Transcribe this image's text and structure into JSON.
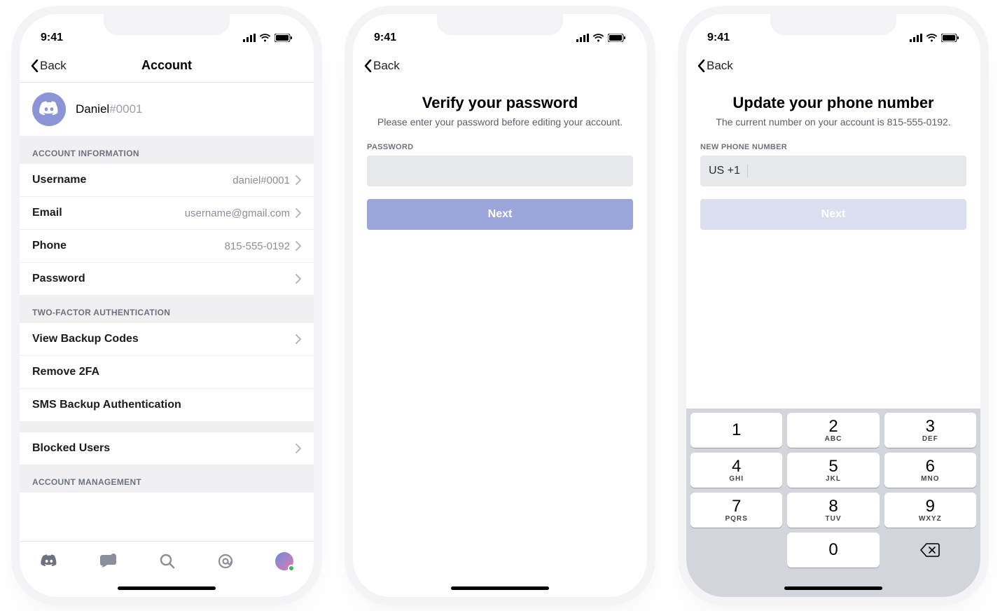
{
  "status": {
    "time": "9:41"
  },
  "screen1": {
    "back": "Back",
    "title": "Account",
    "profile": {
      "name": "Daniel",
      "discriminator": "#0001"
    },
    "sections": {
      "account_info": "ACCOUNT INFORMATION",
      "two_factor": "TWO-FACTOR AUTHENTICATION",
      "account_mgmt": "ACCOUNT MANAGEMENT"
    },
    "rows": {
      "username": {
        "label": "Username",
        "value": "daniel#0001"
      },
      "email": {
        "label": "Email",
        "value": "username@gmail.com"
      },
      "phone": {
        "label": "Phone",
        "value": "815-555-0192"
      },
      "password": {
        "label": "Password"
      },
      "backup": {
        "label": "View Backup Codes"
      },
      "remove2fa": {
        "label": "Remove 2FA"
      },
      "sms": {
        "label": "SMS Backup Authentication"
      },
      "blocked": {
        "label": "Blocked Users"
      }
    }
  },
  "screen2": {
    "back": "Back",
    "title": "Verify your password",
    "subtitle": "Please enter your password before editing your account.",
    "field_label": "PASSWORD",
    "button": "Next"
  },
  "screen3": {
    "back": "Back",
    "title": "Update your phone number",
    "subtitle": "The current number on your account is 815-555-0192.",
    "field_label": "NEW PHONE NUMBER",
    "prefix": "US +1",
    "button": "Next",
    "keys": [
      {
        "digit": "1",
        "letters": ""
      },
      {
        "digit": "2",
        "letters": "ABC"
      },
      {
        "digit": "3",
        "letters": "DEF"
      },
      {
        "digit": "4",
        "letters": "GHI"
      },
      {
        "digit": "5",
        "letters": "JKL"
      },
      {
        "digit": "6",
        "letters": "MNO"
      },
      {
        "digit": "7",
        "letters": "PQRS"
      },
      {
        "digit": "8",
        "letters": "TUV"
      },
      {
        "digit": "9",
        "letters": "WXYZ"
      },
      {
        "digit": "0",
        "letters": ""
      }
    ]
  }
}
